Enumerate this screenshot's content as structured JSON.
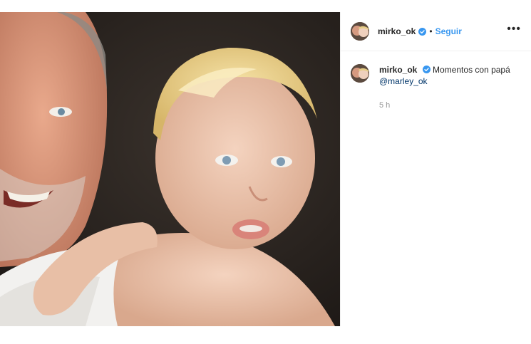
{
  "post": {
    "username": "mirko_ok",
    "follow_label": "Seguir",
    "separator": "•",
    "more_label": "•••",
    "caption": {
      "username": "mirko_ok",
      "text": "Momentos con papá",
      "mention": "@marley_ok",
      "time": "5 h"
    }
  },
  "colors": {
    "accent": "#3897f0",
    "verified": "#3897f0",
    "mention": "#003569"
  },
  "icons": {
    "verified": "verified-badge-icon",
    "more": "more-options-icon"
  }
}
